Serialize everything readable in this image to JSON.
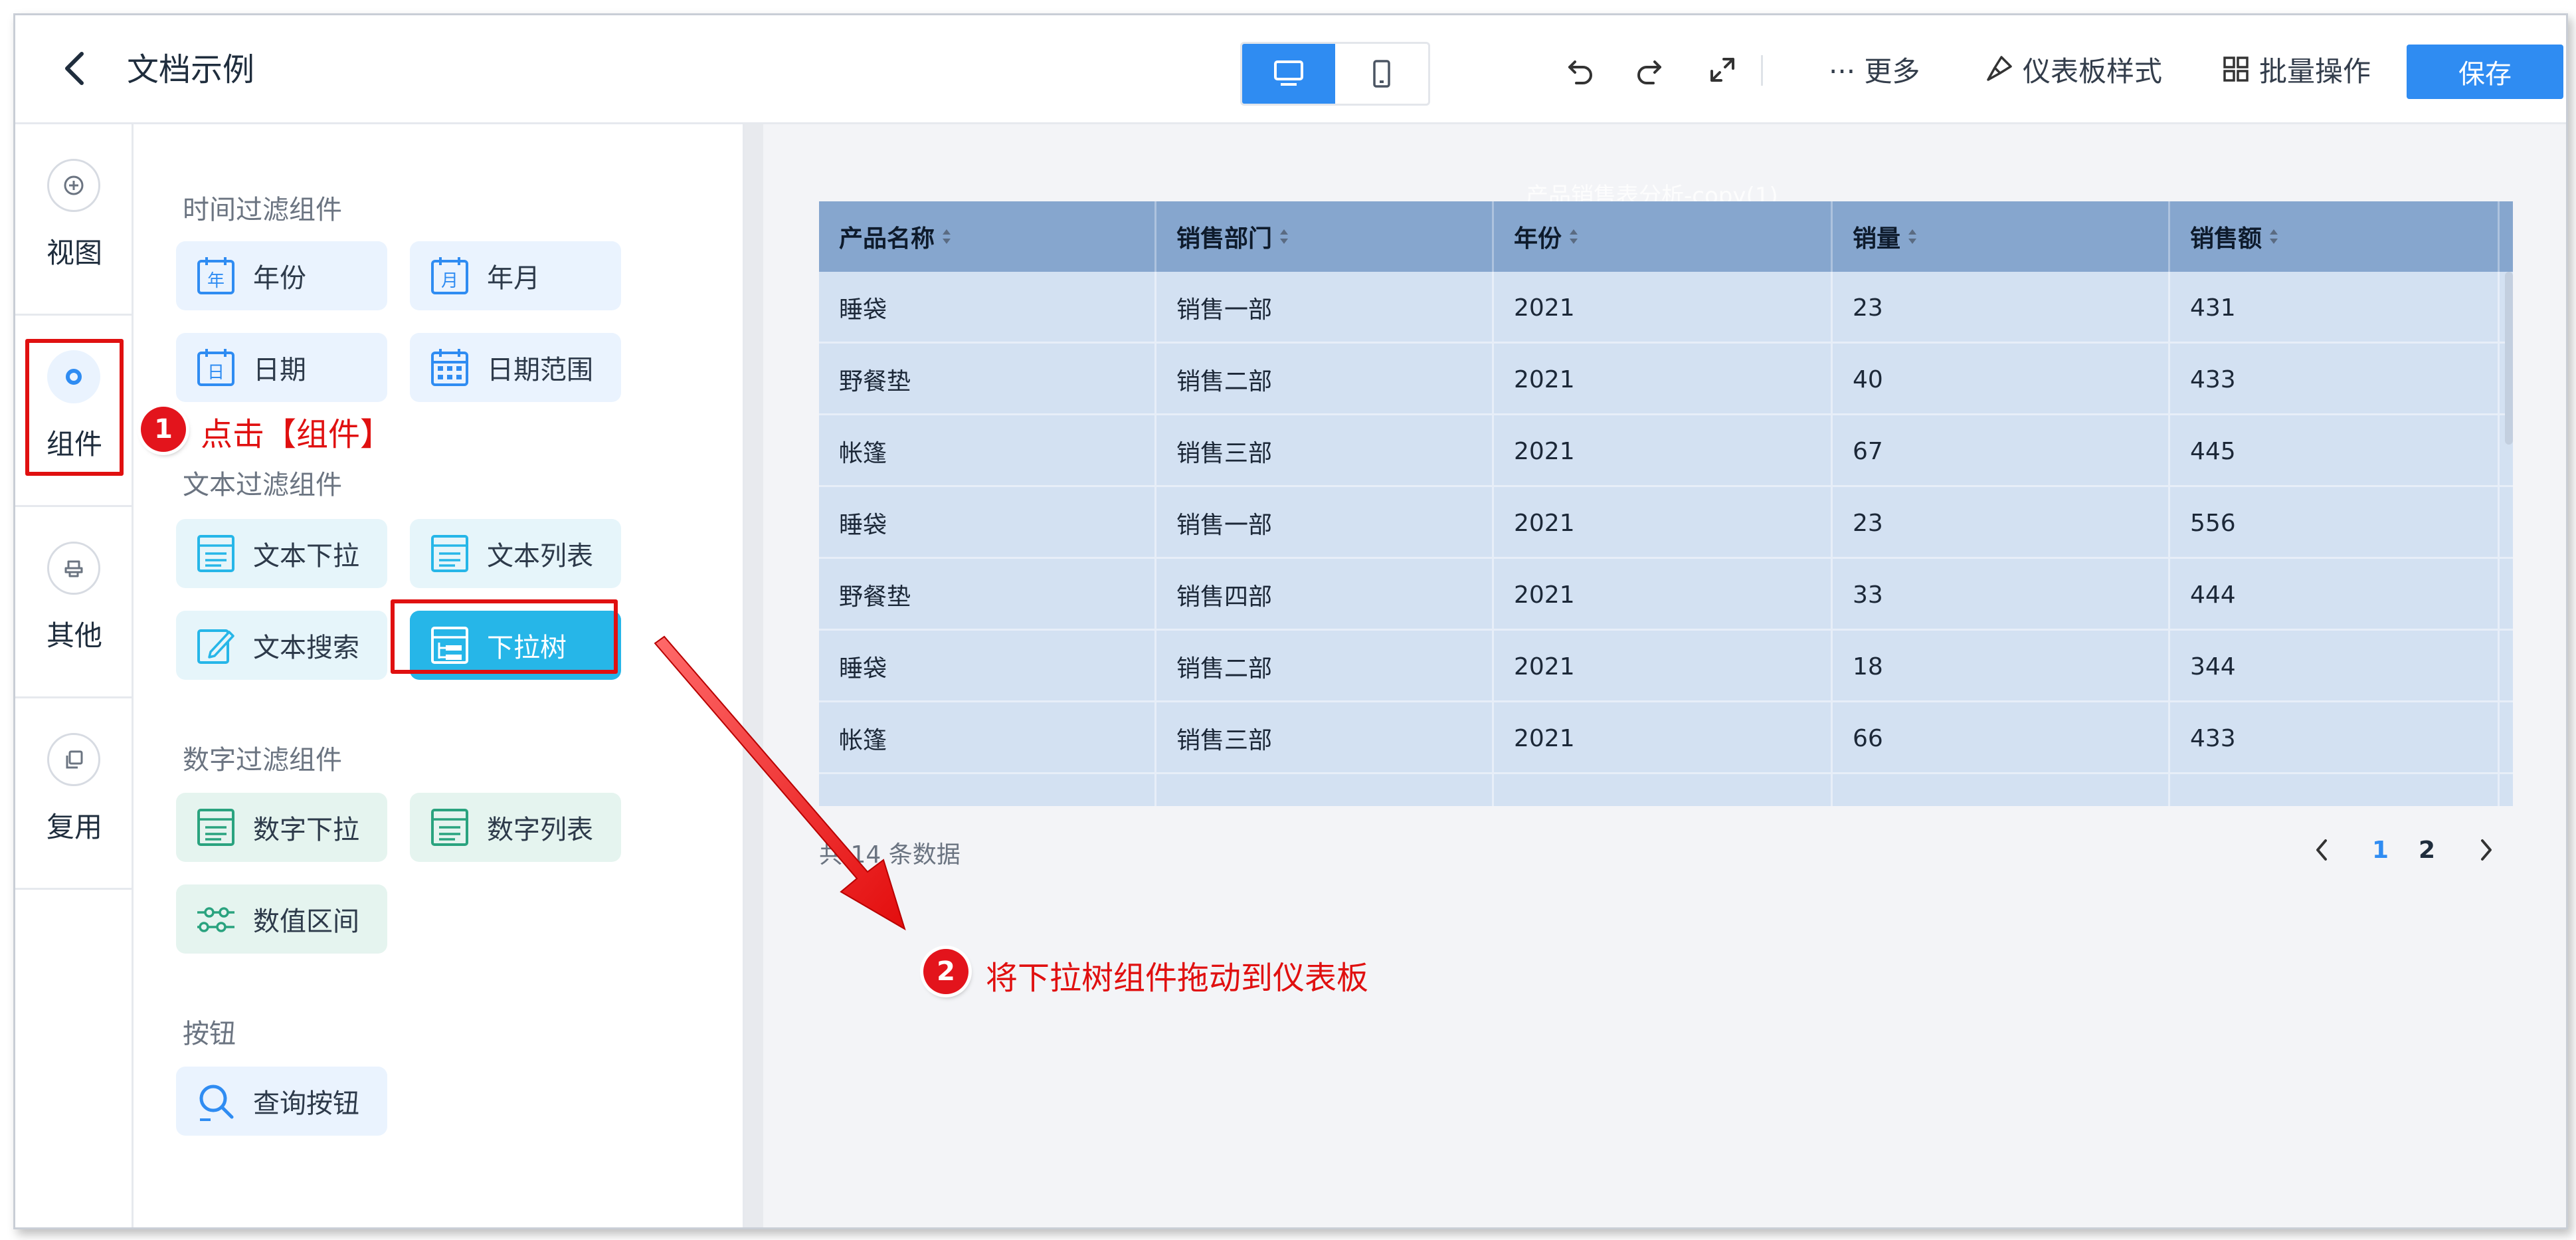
{
  "header": {
    "title": "文档示例",
    "more_label": "··· 更多",
    "style_label": "仪表板样式",
    "batch_label": "批量操作",
    "save_label": "保存"
  },
  "rail": {
    "items": [
      {
        "label": "视图"
      },
      {
        "label": "组件"
      },
      {
        "label": "其他"
      },
      {
        "label": "复用"
      }
    ]
  },
  "panel": {
    "sections": [
      {
        "title": "时间过滤组件",
        "items": [
          "年份",
          "年月",
          "日期",
          "日期范围"
        ]
      },
      {
        "title": "文本过滤组件",
        "items": [
          "文本下拉",
          "文本列表",
          "文本搜索",
          "下拉树"
        ]
      },
      {
        "title": "数字过滤组件",
        "items": [
          "数字下拉",
          "数字列表",
          "数值区间"
        ]
      },
      {
        "title": "按钮",
        "items": [
          "查询按钮"
        ]
      }
    ]
  },
  "table": {
    "title": "产品销售表分析-copy(1)",
    "columns": [
      "产品名称",
      "销售部门",
      "年份",
      "销量",
      "销售额"
    ],
    "rows": [
      [
        "睡袋",
        "销售一部",
        "2021",
        "23",
        "431"
      ],
      [
        "野餐垫",
        "销售二部",
        "2021",
        "40",
        "433"
      ],
      [
        "帐篷",
        "销售三部",
        "2021",
        "67",
        "445"
      ],
      [
        "睡袋",
        "销售一部",
        "2021",
        "23",
        "556"
      ],
      [
        "野餐垫",
        "销售四部",
        "2021",
        "33",
        "444"
      ],
      [
        "睡袋",
        "销售二部",
        "2021",
        "18",
        "344"
      ],
      [
        "帐篷",
        "销售三部",
        "2021",
        "66",
        "433"
      ]
    ],
    "total_text": "共 14 条数据",
    "pages": [
      "1",
      "2"
    ],
    "current_page": "1"
  },
  "annotations": {
    "step1_number": "1",
    "step1_text": "点击【组件】",
    "step2_number": "2",
    "step2_text": "将下拉树组件拖动到仪表板"
  },
  "colors": {
    "primary": "#2f8cf2",
    "highlight_component": "#26b6e8",
    "annotation_red": "#e01010",
    "table_header": "#86a6ce",
    "table_body": "#d3e1f2"
  }
}
